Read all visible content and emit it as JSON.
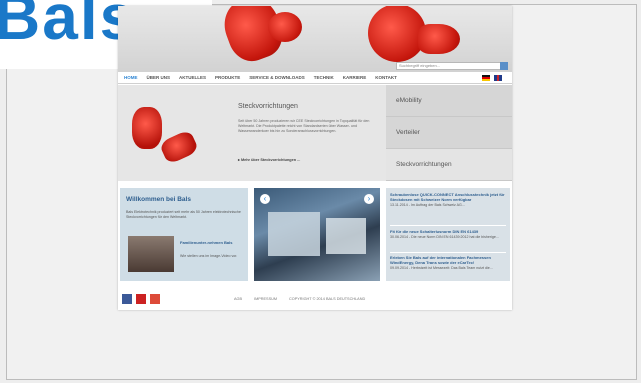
{
  "logo": {
    "text": "Bals"
  },
  "header": {
    "search_placeholder": "Suchbegriff eingeben..."
  },
  "nav": {
    "items": [
      "HOME",
      "ÜBER UNS",
      "AKTUELLES",
      "PRODUKTE",
      "SERVICE & DOWNLOADS",
      "TECHNIK",
      "KARRIERE",
      "KONTAKT"
    ]
  },
  "hero": {
    "title": "Steckvorrichtungen",
    "text": "Seit über 50 Jahren produzieren wir CEE Steckvorrichtungen in Topqualität für den Weltmarkt. Die Produktpalette reicht von Standardserien über Wasser- und Wasserwanderkoer bis hin zu Sonderanschlussvorrichtungen.",
    "link": "▸ Mehr über Steckvorrichtungen ..."
  },
  "side_menu": [
    "eMobility",
    "Verteiler",
    "Steckvorrichtungen"
  ],
  "welcome": {
    "title": "Willkommen bei Bals",
    "text": "Bals Elektrotechnik produziert seit mehr als 50 Jahren elektrotechnische Steckvorrichtungen für den Weltmarkt.",
    "subtitle": "Familienunter-nehmen Bals",
    "subtext": "Wie stellen uns im Image-Video vor."
  },
  "news": [
    {
      "title": "Schraubenlose QUICK-CONNECT Anschlusstechnik jetzt für Steckdosen mit Schweizer Norm verfügbar",
      "text": "13.11.2014 - Im Auftrag der Bals Schweiz AG..."
    },
    {
      "title": "Fit für die neue Schalterlusnorm DIN EN 61439",
      "text": "30.06.2014 - Die neue Norm DIN EN 61439:2012 hat die bisherige..."
    },
    {
      "title": "Erleben Sie Bals auf der internationalen Fachmessen WindEnergy, Dena Trans sowie der eCarTec!",
      "text": "09.09.2014 - Herbstzeit ist Messezeit: Das Bals Team nutzt die..."
    }
  ],
  "footer": {
    "links": [
      "AGB",
      "IMPRESSUM",
      "COPYRIGHT © 2014 BALS DEUTSCHLAND"
    ]
  },
  "colors": {
    "accent": "#2f86d4",
    "brand": "#1a78c8",
    "plug_red": "#d0201a"
  }
}
